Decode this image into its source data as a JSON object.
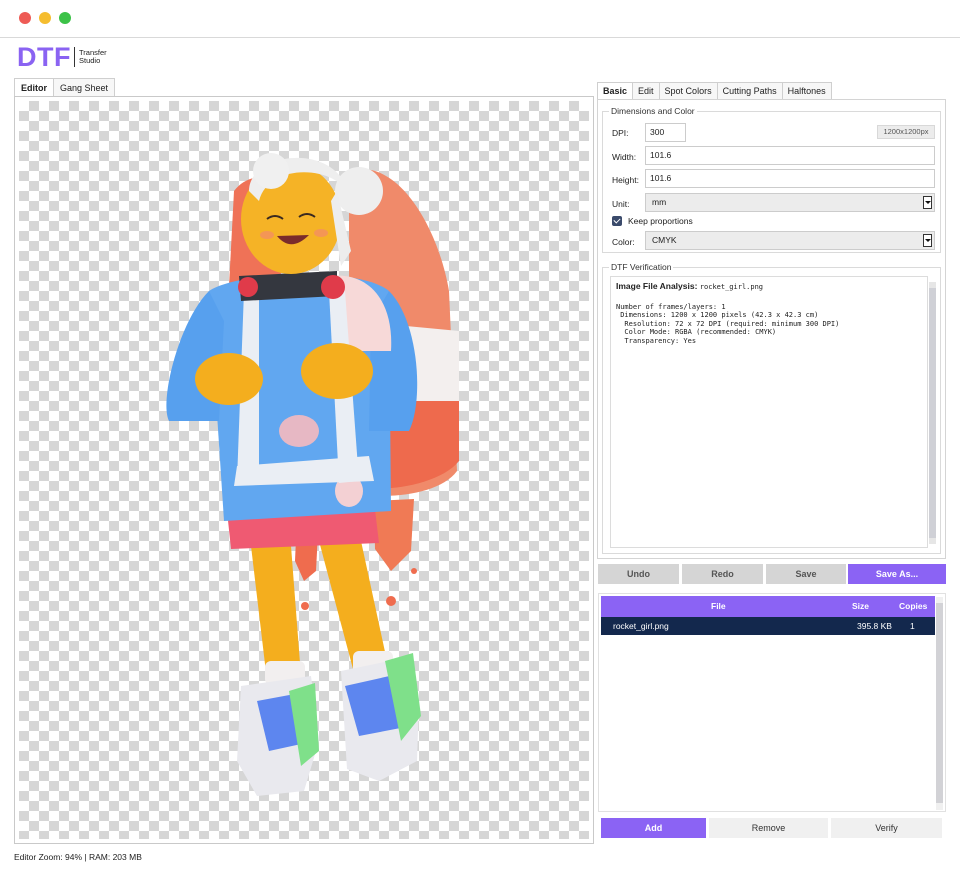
{
  "window": {
    "controls": [
      "close",
      "minimize",
      "maximize"
    ]
  },
  "logo": {
    "mark": "DTF",
    "line1": "Transfer",
    "line2": "Studio",
    "color": "#8a63f2"
  },
  "left_tabs": [
    "Editor",
    "Gang Sheet"
  ],
  "right_tabs": [
    "Basic",
    "Edit",
    "Spot Colors",
    "Cutting Paths",
    "Halftones"
  ],
  "dimensions": {
    "title": "Dimensions and Color",
    "dpi_label": "DPI:",
    "dpi_value": "300",
    "pixel_size": "1200x1200px",
    "width_label": "Width:",
    "width_value": "101.6",
    "height_label": "Height:",
    "height_value": "101.6",
    "unit_label": "Unit:",
    "unit_value": "mm",
    "keep_proportions_label": "Keep proportions",
    "keep_proportions_checked": true,
    "color_label": "Color:",
    "color_value": "CMYK"
  },
  "verification": {
    "title": "DTF Verification",
    "heading": "Image File Analysis:",
    "filename": "rocket_girl.png",
    "lines": [
      "Number of frames/layers: 1",
      " Dimensions: 1200 x 1200 pixels (42.3 x 42.3 cm)",
      "  Resolution: 72 x 72 DPI (required: minimum 300 DPI)",
      "  Color Mode: RGBA (recommended: CMYK)",
      "  Transparency: Yes"
    ]
  },
  "actions": {
    "undo": "Undo",
    "redo": "Redo",
    "save": "Save",
    "save_as": "Save As..."
  },
  "file_table": {
    "columns": [
      "File",
      "Size",
      "Copies"
    ],
    "rows": [
      {
        "file": "rocket_girl.png",
        "size": "395.8 KB",
        "copies": "1"
      }
    ]
  },
  "bottom_buttons": {
    "add": "Add",
    "remove": "Remove",
    "verify": "Verify"
  },
  "status": "Editor Zoom: 94% | RAM: 203 MB",
  "colors": {
    "accent": "#8b63f4",
    "selected_row": "#13284d"
  }
}
